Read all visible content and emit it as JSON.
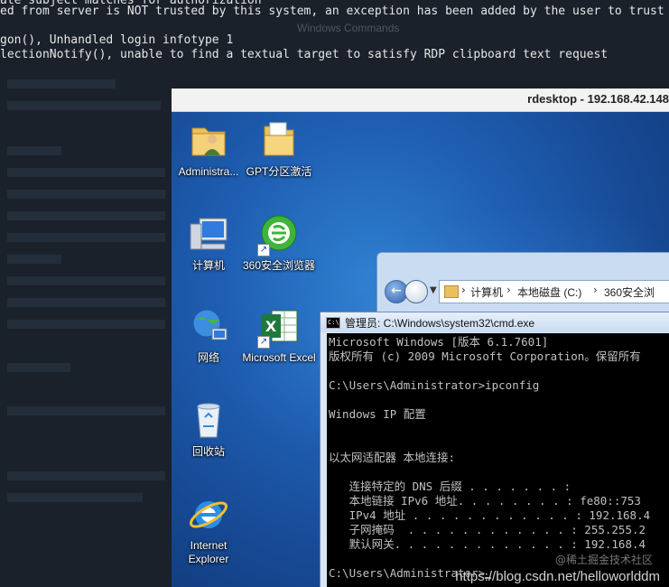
{
  "host_terminal": {
    "lines": [
      "ate subject matches for authorization",
      "ed from server is NOT trusted by this system, an exception has been added by the user to trust",
      "gon(), Unhandled login infotype 1",
      "lectionNotify(), unable to find a textual target to satisfy RDP clipboard text request"
    ],
    "ghost_command_label": "Windows Commands"
  },
  "rdesktop": {
    "title": "rdesktop - 192.168.42.148"
  },
  "desktop_icons": [
    {
      "label": "Administra...",
      "icon": "user-folder-icon"
    },
    {
      "label": "GPT分区激活",
      "icon": "folder-icon"
    },
    {
      "label": "计算机",
      "icon": "computer-icon"
    },
    {
      "label": "360安全浏览器",
      "icon": "browser-360-icon"
    },
    {
      "label": "网络",
      "icon": "network-icon"
    },
    {
      "label": "Microsoft Excel",
      "icon": "excel-icon"
    },
    {
      "label": "回收站",
      "icon": "recycle-bin-icon"
    },
    {
      "label": "Internet Explorer",
      "icon": "ie-icon"
    }
  ],
  "explorer": {
    "breadcrumb": [
      "计算机",
      "本地磁盘 (C:)",
      "360安全浏"
    ]
  },
  "cmd": {
    "title": "管理员: C:\\Windows\\system32\\cmd.exe",
    "lines": [
      "Microsoft Windows [版本 6.1.7601]",
      "版权所有 (c) 2009 Microsoft Corporation。保留所有",
      "",
      "C:\\Users\\Administrator>ipconfig",
      "",
      "Windows IP 配置",
      "",
      "",
      "以太网适配器 本地连接:",
      "",
      "   连接特定的 DNS 后缀 . . . . . . . :",
      "   本地链接 IPv6 地址. . . . . . . . : fe80::753",
      "   IPv4 地址 . . . . . . . . . . . . : 192.168.4",
      "   子网掩码  . . . . . . . . . . . . : 255.255.2",
      "   默认网关. . . . . . . . . . . . . : 192.168.4",
      "",
      "C:\\Users\\Administrator>"
    ]
  },
  "watermark": {
    "url": "https://blog.csdn.net/helloworlddm",
    "cn": "@稀土掘金技术社区"
  },
  "colors": {
    "desktop_blue": "#1f5fb3",
    "cmd_bg": "#000000",
    "cmd_fg": "#c0c0c0"
  }
}
